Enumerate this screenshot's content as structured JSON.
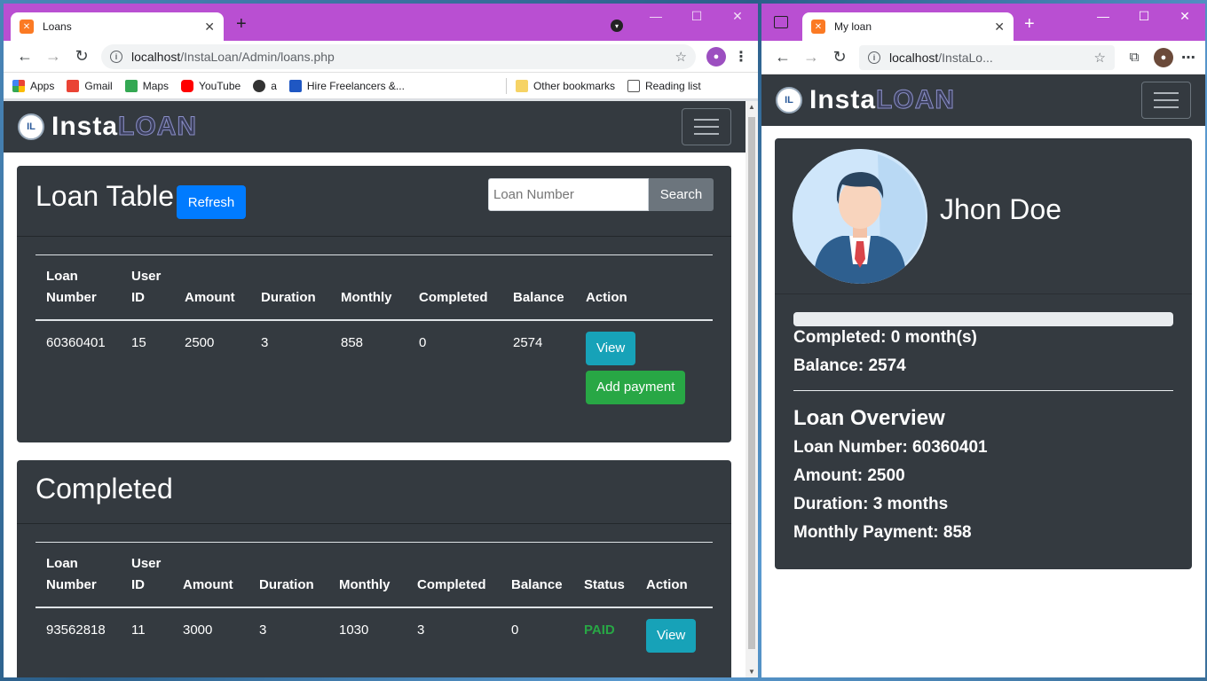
{
  "left_window": {
    "tab_title": "Loans",
    "url_host": "localhost",
    "url_path": "/InstaLoan/Admin/loans.php",
    "bookmarks": [
      "Apps",
      "Gmail",
      "Maps",
      "YouTube",
      "a",
      "Hire Freelancers &...",
      "Other bookmarks",
      "Reading list"
    ],
    "logo_part1": "Insta",
    "logo_part2": "LOAN",
    "loan_table": {
      "title": "Loan Table",
      "refresh_label": "Refresh",
      "search_placeholder": "Loan Number",
      "search_label": "Search",
      "headers": [
        "Loan Number",
        "User ID",
        "Amount",
        "Duration",
        "Monthly",
        "Completed",
        "Balance",
        "Action"
      ],
      "rows": [
        {
          "loan_number": "60360401",
          "user_id": "15",
          "amount": "2500",
          "duration": "3",
          "monthly": "858",
          "completed": "0",
          "balance": "2574",
          "view_label": "View",
          "payment_label": "Add payment"
        }
      ]
    },
    "completed_table": {
      "title": "Completed",
      "headers": [
        "Loan Number",
        "User ID",
        "Amount",
        "Duration",
        "Monthly",
        "Completed",
        "Balance",
        "Status",
        "Action"
      ],
      "rows": [
        {
          "loan_number": "93562818",
          "user_id": "11",
          "amount": "3000",
          "duration": "3",
          "monthly": "1030",
          "completed": "3",
          "balance": "0",
          "status": "PAID",
          "view_label": "View"
        }
      ]
    }
  },
  "right_window": {
    "tab_title": "My loan",
    "url_host": "localhost",
    "url_path": "/InstaLo...",
    "logo_part1": "Insta",
    "logo_part2": "LOAN",
    "profile_name": "Jhon Doe",
    "progress_fraction": 0,
    "completed_text": "Completed: 0 month(s)",
    "balance_text": "Balance: 2574",
    "overview_title": "Loan Overview",
    "loan_number_text": "Loan Number: 60360401",
    "amount_text": "Amount: 2500",
    "duration_text": "Duration: 3 months",
    "monthly_text": "Monthly Payment: 858"
  },
  "colors": {
    "titlebar": "#b94fd2",
    "navbar": "#343a40",
    "primary": "#007bff",
    "info": "#17a2b8",
    "success": "#28a745",
    "secondary": "#6c757d"
  }
}
